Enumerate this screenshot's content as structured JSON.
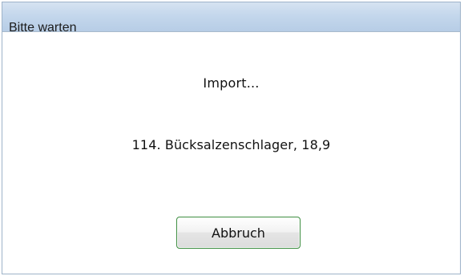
{
  "window": {
    "title": "Bitte warten"
  },
  "status": {
    "title": "Import...",
    "detail": "114. Bücksalzenschlager, 18,9"
  },
  "buttons": {
    "cancel": "Abbruch"
  }
}
